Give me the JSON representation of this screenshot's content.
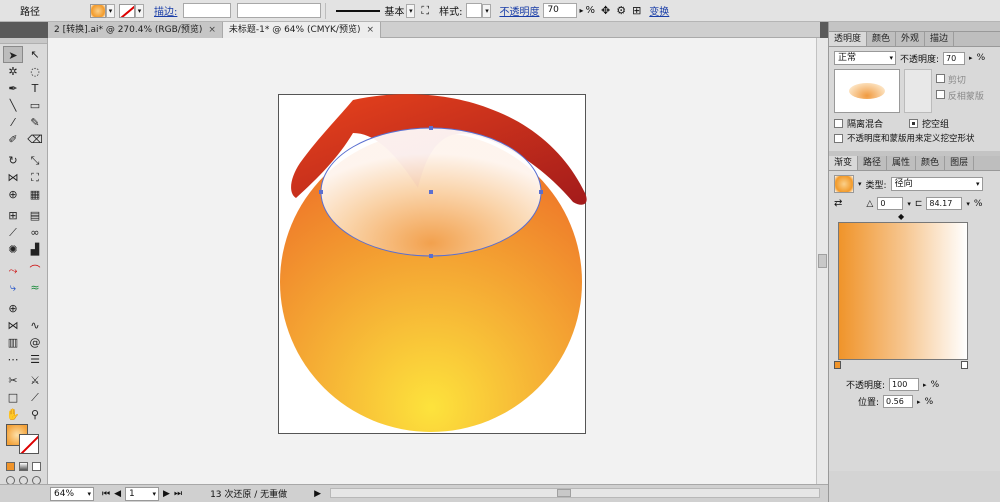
{
  "control_bar": {
    "selection_label": "路径",
    "stroke_link": "描边:",
    "stroke_weight": "",
    "brush_name": "基本",
    "style_label": "样式:",
    "opacity_link": "不透明度",
    "opacity_value": "70",
    "opacity_unit": "%",
    "transform_link": "变换"
  },
  "doc_tabs": [
    {
      "label": "2 [转换].ai* @ 270.4% (RGB/预览)",
      "close": "×"
    },
    {
      "label": "未标题-1* @ 64% (CMYK/预览)",
      "close": "×"
    }
  ],
  "transparency_panel": {
    "tabs": [
      "透明度",
      "颜色",
      "外观",
      "描边"
    ],
    "blend_mode": "正常",
    "opacity_label": "不透明度:",
    "opacity_value": "70",
    "opacity_unit": "%",
    "clip_label": "剪切",
    "invert_mask_label": "反相蒙版",
    "isolate_blend_label": "隔离混合",
    "knockout_group_label": "挖空组",
    "define_knockout_label": "不透明度和蒙版用来定义挖空形状"
  },
  "gradient_panel": {
    "tabs": [
      "渐变",
      "路径",
      "属性",
      "颜色",
      "图层"
    ],
    "type_label": "类型:",
    "type_value": "径向",
    "angle_value": "0",
    "aspect_value": "84.17",
    "aspect_unit": "%",
    "opacity_label": "不透明度:",
    "opacity_value": "100",
    "opacity_unit": "%",
    "location_label": "位置:",
    "location_value": "0.56",
    "location_unit": "%"
  },
  "status_bar": {
    "zoom": "64%",
    "artboard_index": "1",
    "history": "13 次还原 / 无重做"
  },
  "colors": {
    "orange": "#f0942a",
    "yellow": "#fde33c",
    "red": "#c8281c",
    "selection_blue": "#5a6fd0"
  }
}
